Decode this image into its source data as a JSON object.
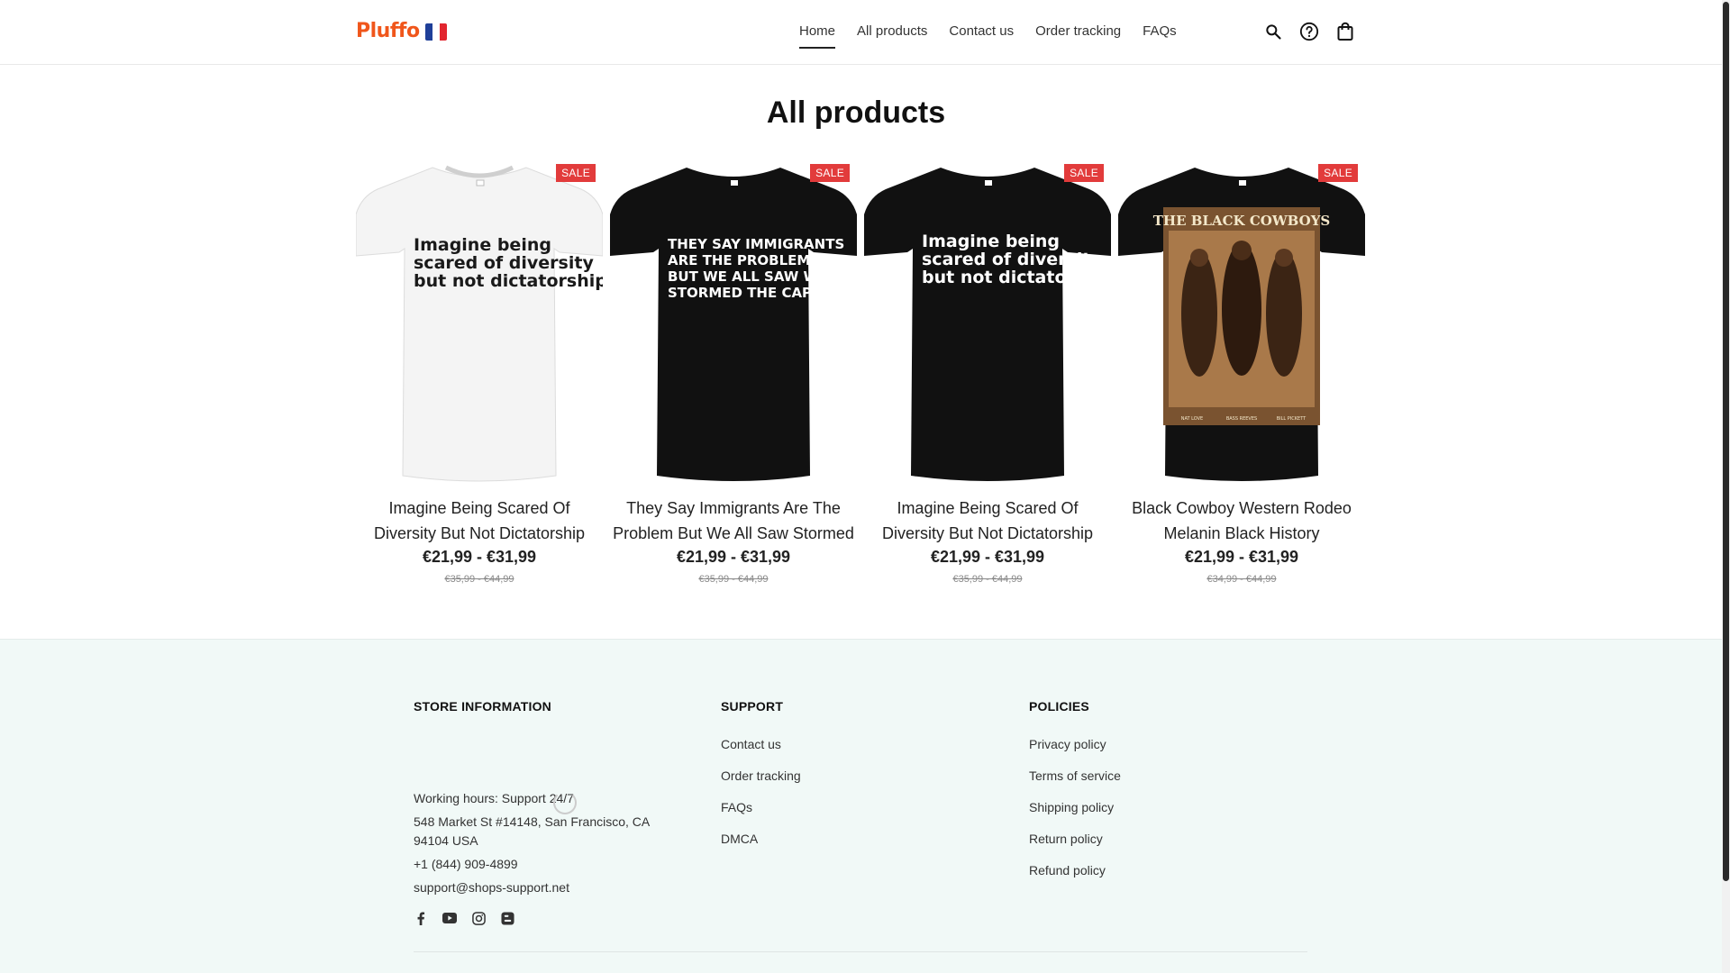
{
  "header": {
    "logo": "Pluffo",
    "flag_colors": [
      "#1f3f99",
      "#ffffff",
      "#e2262f"
    ],
    "nav": [
      {
        "label": "Home",
        "active": true
      },
      {
        "label": "All products"
      },
      {
        "label": "Contact us"
      },
      {
        "label": "Order tracking"
      },
      {
        "label": "FAQs"
      }
    ],
    "icons": [
      "search-icon",
      "help-icon",
      "shopping-bag-icon"
    ]
  },
  "main": {
    "title": "All products",
    "products": [
      {
        "title": "Imagine Being Scared Of Diversity But Not Dictatorship",
        "price": "€21,99 - €31,99",
        "old_price": "€35,99 - €44,99",
        "badge": "SALE",
        "shirt_color": "#f4f4f4",
        "print_lines": [
          "Imagine being",
          "scared of diversity",
          "but not dictatorship."
        ],
        "print_color": "#1a1a1a"
      },
      {
        "title": "They Say Immigrants Are The Problem But We All Saw Stormed",
        "price": "€21,99 - €31,99",
        "old_price": "€35,99 - €44,99",
        "badge": "SALE",
        "shirt_color": "#111111",
        "print_lines": [
          "THEY SAY IMMIGRANTS",
          "ARE THE PROBLEM.",
          "BUT WE ALL SAW WHO",
          "STORMED THE CAPITOL."
        ],
        "print_color": "#ffffff"
      },
      {
        "title": "Imagine Being Scared Of Diversity But Not Dictatorship",
        "price": "€21,99 - €31,99",
        "old_price": "€35,99 - €44,99",
        "badge": "SALE",
        "shirt_color": "#111111",
        "print_lines": [
          "Imagine being",
          "scared of diversity",
          "but not dictatorship."
        ],
        "print_color": "#ffffff"
      },
      {
        "title": "Black Cowboy Western Rodeo Melanin Black History",
        "price": "€21,99 - €31,99",
        "old_price": "€34,99 - €44,99",
        "badge": "SALE",
        "shirt_color": "#111111",
        "print_lines": [
          "THE BLACK COWBOYS"
        ],
        "print_color": "#f3e7c9",
        "caption_lines": [
          "NAT LOVE",
          "BASS REEVES",
          "BILL PICKETT"
        ]
      }
    ]
  },
  "footer": {
    "store": {
      "heading": "STORE INFORMATION",
      "hours": "Working hours: Support 24/7",
      "address": "548 Market St #14148, San Francisco, CA 94104 USA",
      "phone": "+1 (844) 909-4899",
      "email": "support@shops-support.net",
      "social_icons": [
        "facebook-icon",
        "youtube-icon",
        "instagram-icon",
        "blogger-icon"
      ]
    },
    "support": {
      "heading": "SUPPORT",
      "links": [
        "Contact us",
        "Order tracking",
        "FAQs",
        "DMCA"
      ]
    },
    "policies": {
      "heading": "POLICIES",
      "links": [
        "Privacy policy",
        "Terms of service",
        "Shipping policy",
        "Return policy",
        "Refund policy"
      ]
    }
  },
  "colors": {
    "sale_badge": "#e23b3b",
    "footer_bg": "#f1f9f7",
    "logo": "#f0561b"
  }
}
